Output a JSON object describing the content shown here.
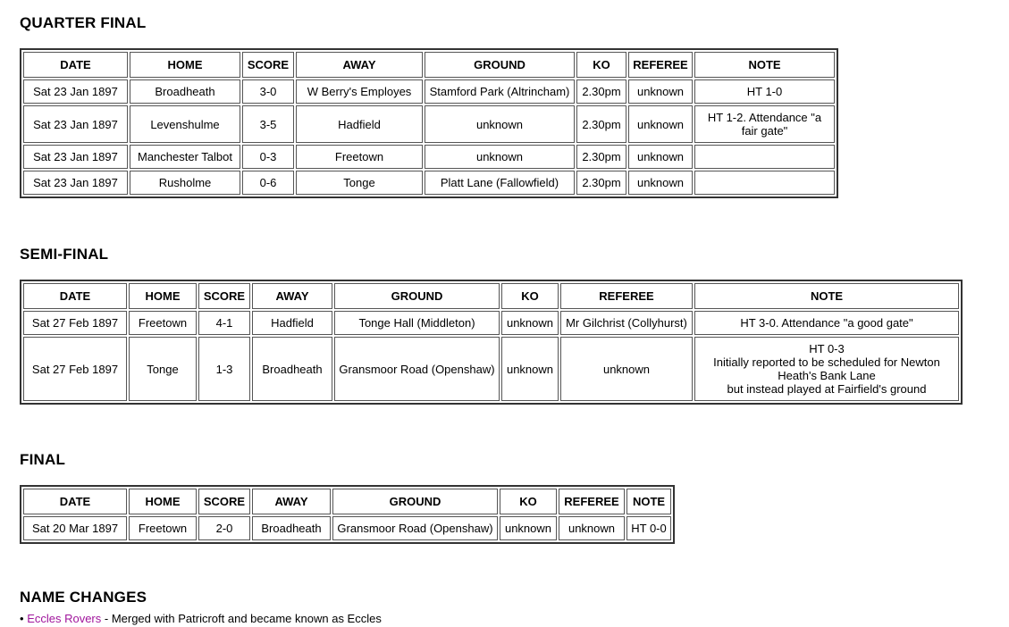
{
  "columns": [
    "DATE",
    "HOME",
    "SCORE",
    "AWAY",
    "GROUND",
    "KO",
    "REFEREE",
    "NOTE"
  ],
  "unknown_label": "unknown",
  "colors": {
    "link": "#a0159c",
    "unknown_text": "#d4d4d4",
    "table_outer_border": "#333333",
    "cell_border": "#555555",
    "text": "#000000",
    "background": "#ffffff"
  },
  "sections": {
    "quarter_final": {
      "title": "QUARTER FINAL",
      "headers": [
        "DATE",
        "HOME",
        "SCORE",
        "AWAY",
        "GROUND",
        "KO",
        "REFEREE",
        "NOTE"
      ],
      "rows": [
        {
          "date": "Sat 23 Jan 1897",
          "home": "Broadheath",
          "home_bold": true,
          "score": "3-0",
          "away": "W Berry's Employes",
          "away_bold": false,
          "ground": "Stamford Park (Altrincham)",
          "ground_unknown": false,
          "ko": "2.30pm",
          "referee": "unknown",
          "referee_unknown": true,
          "note": "HT 1-0"
        },
        {
          "date": "Sat 23 Jan 1897",
          "home": "Levenshulme",
          "home_bold": false,
          "score": "3-5",
          "away": "Hadfield",
          "away_bold": true,
          "ground": "unknown",
          "ground_unknown": true,
          "ko": "2.30pm",
          "referee": "unknown",
          "referee_unknown": true,
          "note": "HT 1-2. Attendance \"a fair gate\""
        },
        {
          "date": "Sat 23 Jan 1897",
          "home": "Manchester Talbot",
          "home_bold": false,
          "score": "0-3",
          "away": "Freetown",
          "away_bold": true,
          "ground": "unknown",
          "ground_unknown": true,
          "ko": "2.30pm",
          "referee": "unknown",
          "referee_unknown": true,
          "note": ""
        },
        {
          "date": "Sat 23 Jan 1897",
          "home": "Rusholme",
          "home_bold": false,
          "score": "0-6",
          "away": "Tonge",
          "away_bold": true,
          "ground": "Platt Lane (Fallowfield)",
          "ground_unknown": false,
          "ko": "2.30pm",
          "referee": "unknown",
          "referee_unknown": true,
          "note": ""
        }
      ]
    },
    "semi_final": {
      "title": "SEMI-FINAL",
      "headers": [
        "DATE",
        "HOME",
        "SCORE",
        "AWAY",
        "GROUND",
        "KO",
        "REFEREE",
        "NOTE"
      ],
      "rows": [
        {
          "date": "Sat 27 Feb 1897",
          "home": "Freetown",
          "home_bold": true,
          "score": "4-1",
          "away": "Hadfield",
          "away_bold": false,
          "ground": "Tonge Hall (Middleton)",
          "ko": "unknown",
          "ko_unknown": true,
          "referee": "Mr Gilchrist (Collyhurst)",
          "referee_unknown": false,
          "note": "HT 3-0. Attendance \"a good gate\""
        },
        {
          "date": "Sat 27 Feb 1897",
          "home": "Tonge",
          "home_bold": false,
          "score": "1-3",
          "away": "Broadheath",
          "away_bold": true,
          "ground": "Gransmoor Road (Openshaw)",
          "ko": "unknown",
          "ko_unknown": true,
          "referee": "unknown",
          "referee_unknown": true,
          "note_lines": [
            "HT 0-3",
            "Initially reported to be scheduled for Newton Heath's Bank Lane",
            "but instead played at Fairfield's ground"
          ]
        }
      ]
    },
    "final": {
      "title": "FINAL",
      "headers": [
        "DATE",
        "HOME",
        "SCORE",
        "AWAY",
        "GROUND",
        "KO",
        "REFEREE",
        "NOTE"
      ],
      "rows": [
        {
          "date": "Sat 20 Mar 1897",
          "home": "Freetown",
          "home_bold": true,
          "score": "2-0",
          "away": "Broadheath",
          "away_bold": false,
          "ground": "Gransmoor Road (Openshaw)",
          "ko": "unknown",
          "ko_unknown": true,
          "referee": "unknown",
          "referee_unknown": true,
          "note": "HT 0-0"
        }
      ]
    },
    "name_changes": {
      "title": "NAME CHANGES",
      "items": [
        {
          "bullet": "•",
          "club": "Eccles Rovers",
          "description": " - Merged with Patricroft and became known as Eccles"
        }
      ]
    }
  }
}
